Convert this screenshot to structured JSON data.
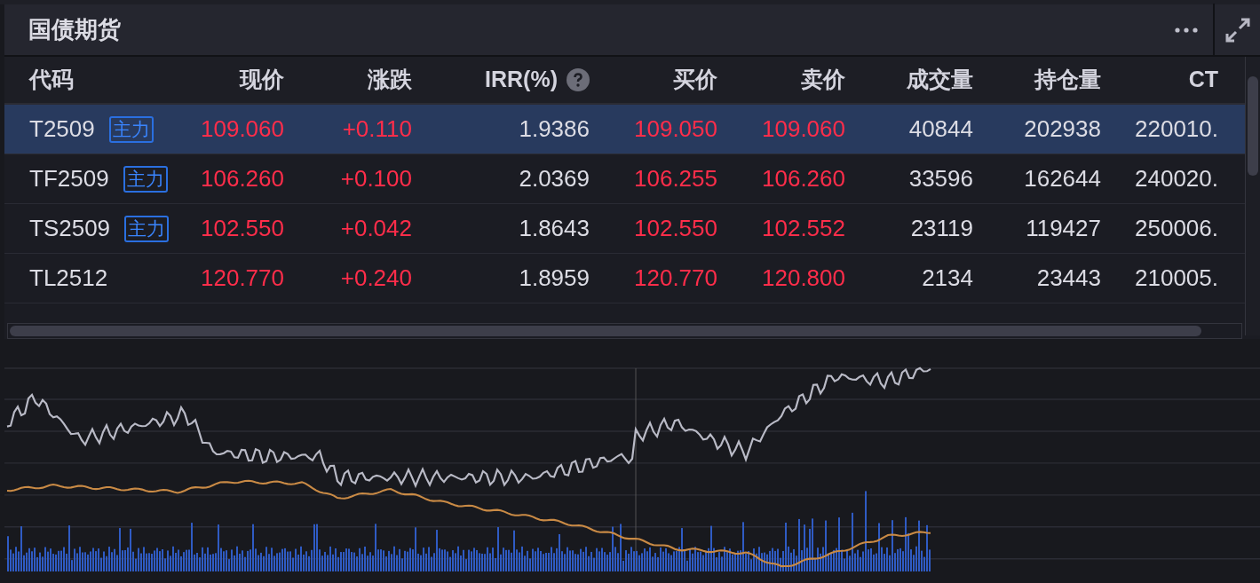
{
  "panel": {
    "title": "国债期货"
  },
  "table": {
    "columns": [
      {
        "label": "代码",
        "has_help": false
      },
      {
        "label": "现价",
        "has_help": false
      },
      {
        "label": "涨跌",
        "has_help": false
      },
      {
        "label": "IRR(%)",
        "has_help": true
      },
      {
        "label": "买价",
        "has_help": false
      },
      {
        "label": "卖价",
        "has_help": false
      },
      {
        "label": "成交量",
        "has_help": false
      },
      {
        "label": "持仓量",
        "has_help": false
      },
      {
        "label": "CT",
        "has_help": false
      }
    ],
    "rows": [
      {
        "selected": true,
        "code": "T2509",
        "tag": "主力",
        "price": "109.060",
        "change": "+0.110",
        "irr": "1.9386",
        "bid": "109.050",
        "ask": "109.060",
        "volume": "40844",
        "open_interest": "202938",
        "column_9": "220010."
      },
      {
        "selected": false,
        "code": "TF2509",
        "tag": "主力",
        "price": "106.260",
        "change": "+0.100",
        "irr": "2.0369",
        "bid": "106.255",
        "ask": "106.260",
        "volume": "33596",
        "open_interest": "162644",
        "column_9": "240020."
      },
      {
        "selected": false,
        "code": "TS2509",
        "tag": "主力",
        "price": "102.550",
        "change": "+0.042",
        "irr": "1.8643",
        "bid": "102.550",
        "ask": "102.552",
        "volume": "23119",
        "open_interest": "119427",
        "column_9": "250006."
      },
      {
        "selected": false,
        "code": "TL2512",
        "price": "120.770",
        "change": "+0.240",
        "irr": "1.8959",
        "bid": "120.770",
        "ask": "120.800",
        "volume": "2134",
        "open_interest": "23443",
        "column_9": "210005."
      }
    ]
  }
}
